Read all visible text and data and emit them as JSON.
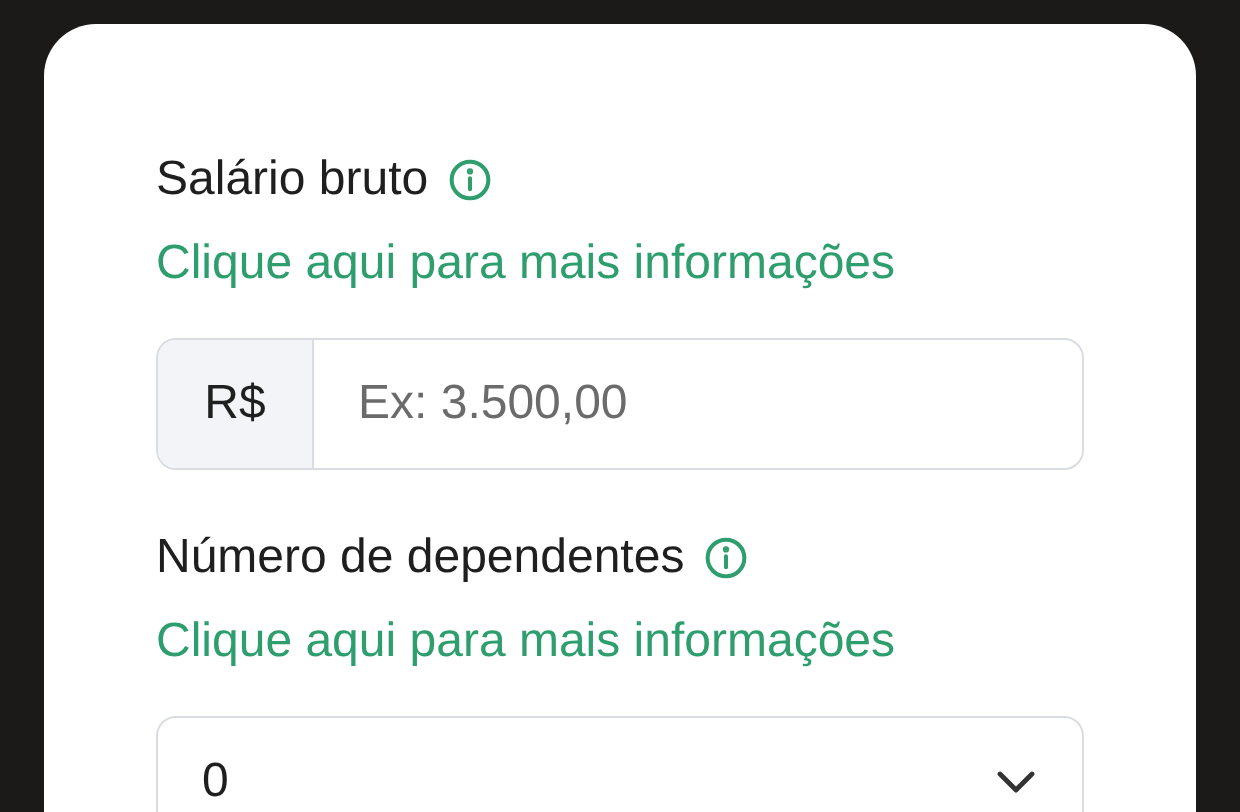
{
  "fields": [
    {
      "kind": "currency",
      "label": "Salário bruto",
      "link": "Clique aqui para mais informações",
      "prefix": "R$",
      "placeholder": "Ex: 3.500,00"
    },
    {
      "kind": "select",
      "label": "Número de dependentes",
      "link": "Clique aqui para mais informações",
      "value": "0"
    }
  ]
}
